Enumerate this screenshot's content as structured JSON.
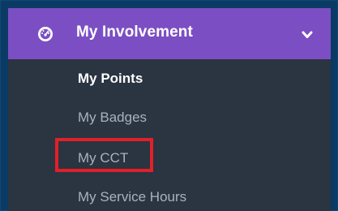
{
  "menu": {
    "header": {
      "label": "My Involvement",
      "icon": "dashboard-gauge-icon",
      "expanded": true
    },
    "items": [
      {
        "label": "My Points",
        "state": "active"
      },
      {
        "label": "My Badges",
        "state": "inactive"
      },
      {
        "label": "My CCT",
        "state": "inactive",
        "highlighted": true
      },
      {
        "label": "My Service Hours",
        "state": "inactive"
      }
    ]
  },
  "colors": {
    "header_bg": "#7b4fc3",
    "menu_bg": "#2b3441",
    "page_bg": "#0b3a64",
    "highlight": "#e0202a"
  }
}
